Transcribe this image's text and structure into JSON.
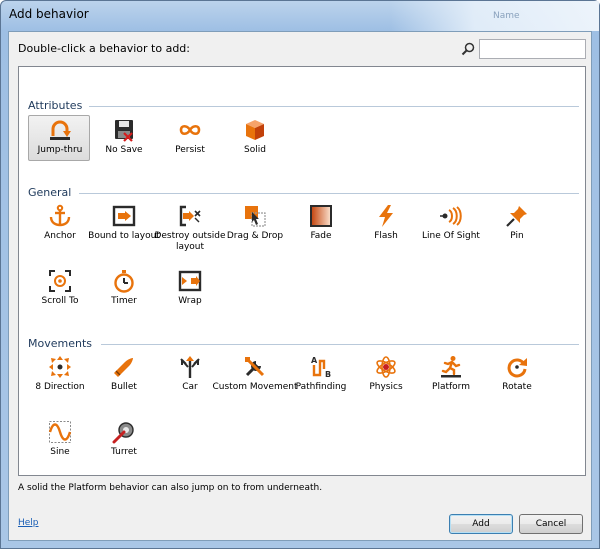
{
  "window": {
    "title": "Add behavior",
    "ghost_title": "Name"
  },
  "dialog": {
    "instruction": "Double-click a behavior to add:",
    "search_value": "",
    "status": "A solid the Platform behavior can also jump on to from underneath.",
    "help_label": "Help",
    "add_label": "Add",
    "cancel_label": "Cancel"
  },
  "sections": [
    {
      "title": "Attributes",
      "items": [
        {
          "label": "Jump-thru",
          "icon": "jump-thru-icon",
          "selected": true
        },
        {
          "label": "No Save",
          "icon": "floppy-disk-icon",
          "selected": false
        },
        {
          "label": "Persist",
          "icon": "infinity-icon",
          "selected": false
        },
        {
          "label": "Solid",
          "icon": "solid-block-icon",
          "selected": false
        }
      ]
    },
    {
      "title": "General",
      "items": [
        {
          "label": "Anchor",
          "icon": "anchor-icon"
        },
        {
          "label": "Bound to layout",
          "icon": "bound-to-layout-icon"
        },
        {
          "label": "Destroy outside layout",
          "icon": "destroy-outside-icon"
        },
        {
          "label": "Drag & Drop",
          "icon": "drag-drop-icon"
        },
        {
          "label": "Fade",
          "icon": "fade-icon"
        },
        {
          "label": "Flash",
          "icon": "lightning-icon"
        },
        {
          "label": "Line Of Sight",
          "icon": "line-of-sight-icon"
        },
        {
          "label": "Pin",
          "icon": "pushpin-icon"
        },
        {
          "label": "Scroll To",
          "icon": "scroll-to-icon"
        },
        {
          "label": "Timer",
          "icon": "stopwatch-icon"
        },
        {
          "label": "Wrap",
          "icon": "wrap-icon"
        }
      ]
    },
    {
      "title": "Movements",
      "items": [
        {
          "label": "8 Direction",
          "icon": "eight-direction-icon"
        },
        {
          "label": "Bullet",
          "icon": "bullet-icon"
        },
        {
          "label": "Car",
          "icon": "car-arrows-icon"
        },
        {
          "label": "Custom Movement",
          "icon": "wrench-screwdriver-icon"
        },
        {
          "label": "Pathfinding",
          "icon": "pathfinding-icon"
        },
        {
          "label": "Physics",
          "icon": "atom-icon"
        },
        {
          "label": "Platform",
          "icon": "running-man-icon"
        },
        {
          "label": "Rotate",
          "icon": "rotate-icon"
        },
        {
          "label": "Sine",
          "icon": "sine-wave-icon"
        },
        {
          "label": "Turret",
          "icon": "turret-icon"
        }
      ]
    }
  ],
  "colors": {
    "accent_orange": "#e8730c",
    "dark_icon": "#2b2b2b",
    "section_title": "#1e395b"
  }
}
